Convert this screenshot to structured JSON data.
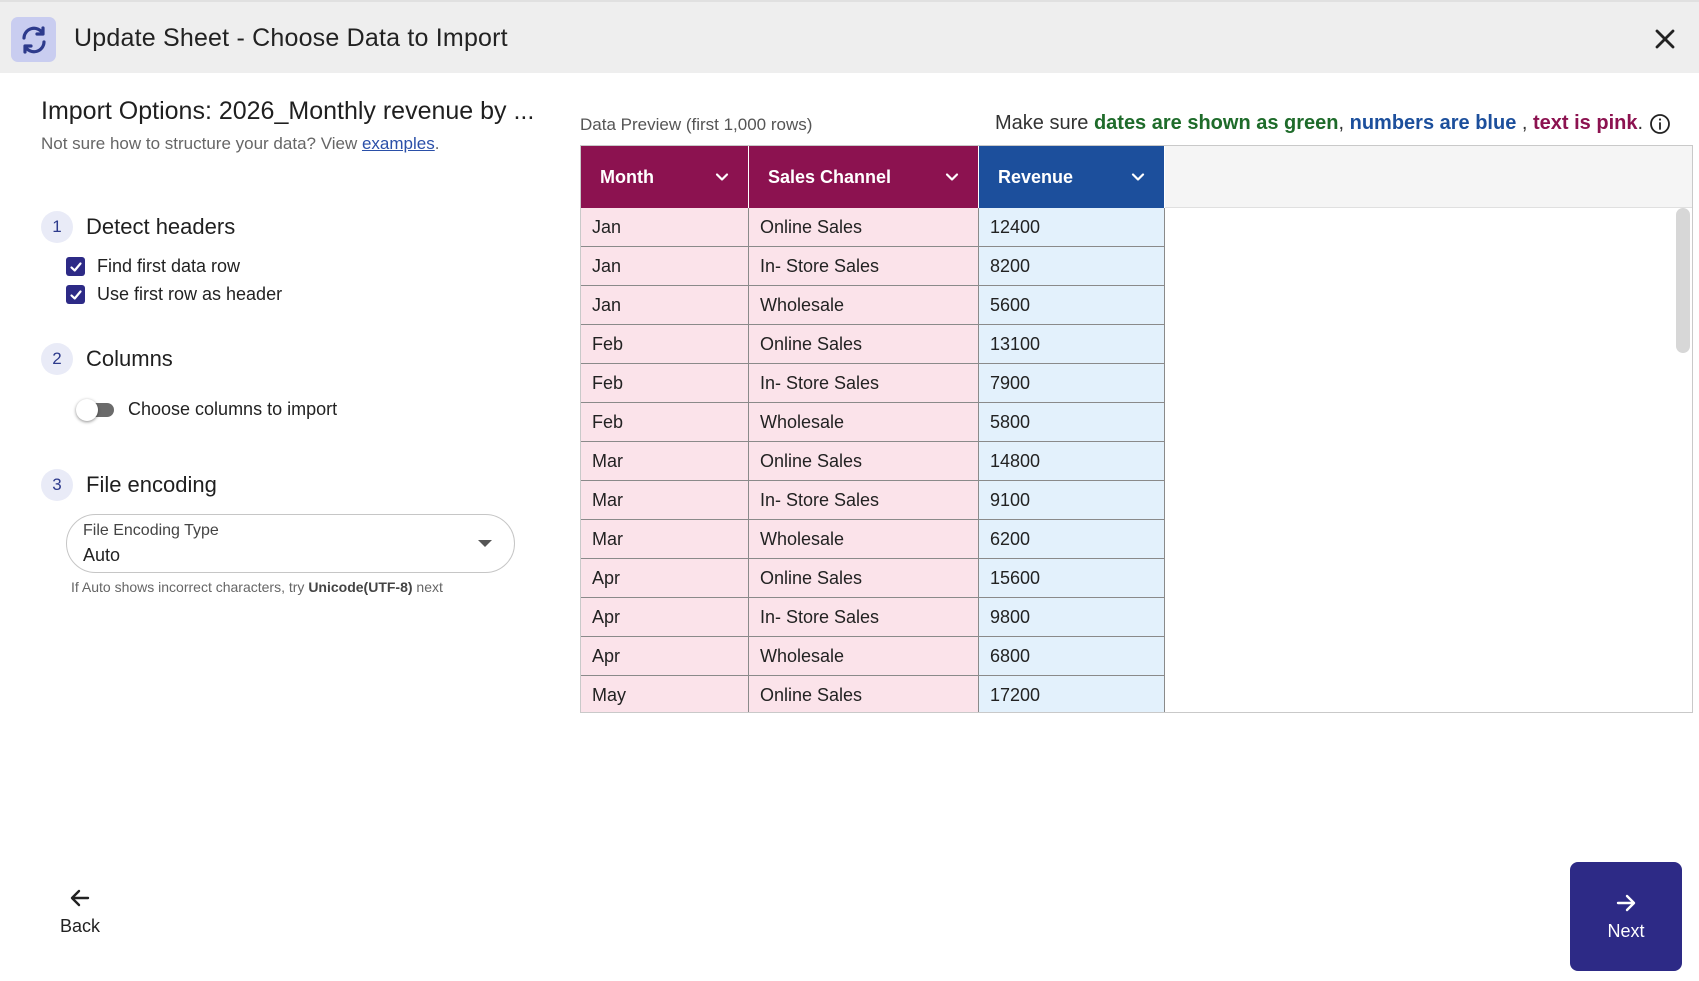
{
  "header": {
    "title": "Update Sheet - Choose Data to Import"
  },
  "options": {
    "title": "Import Options: 2026_Monthly revenue by ...",
    "subtitle_prefix": "Not sure how to structure your data? View ",
    "examples_link": "examples",
    "subtitle_suffix": "."
  },
  "steps": {
    "detect": {
      "number": "1",
      "label": "Detect headers",
      "find_first_row": {
        "label": "Find first data row",
        "checked": true
      },
      "use_header": {
        "label": "Use first row as header",
        "checked": true
      }
    },
    "columns": {
      "number": "2",
      "label": "Columns",
      "toggle_label": "Choose columns to import",
      "toggle_on": false
    },
    "encoding": {
      "number": "3",
      "label": "File encoding",
      "select_label": "File Encoding Type",
      "select_value": "Auto",
      "help_prefix": "If Auto shows incorrect characters, try ",
      "help_bold": "Unicode(UTF-8)",
      "help_suffix": " next"
    }
  },
  "preview": {
    "label": "Data Preview (first 1,000 rows)",
    "legend": {
      "prefix": "Make sure ",
      "green": "dates are shown as green",
      "sep1": ", ",
      "blue": "numbers are blue",
      "sep2": " , ",
      "pink": "text is pink",
      "suffix": "."
    },
    "columns": [
      {
        "name": "Month",
        "color": "#8c1250"
      },
      {
        "name": "Sales Channel",
        "color": "#8c1250"
      },
      {
        "name": "Revenue",
        "color": "#1c4f9c"
      }
    ],
    "rows": [
      [
        "Jan",
        "Online Sales",
        "12400"
      ],
      [
        "Jan",
        "In- Store Sales",
        "8200"
      ],
      [
        "Jan",
        "Wholesale",
        "5600"
      ],
      [
        "Feb",
        "Online Sales",
        "13100"
      ],
      [
        "Feb",
        "In- Store Sales",
        "7900"
      ],
      [
        "Feb",
        "Wholesale",
        "5800"
      ],
      [
        "Mar",
        "Online Sales",
        "14800"
      ],
      [
        "Mar",
        "In- Store Sales",
        "9100"
      ],
      [
        "Mar",
        "Wholesale",
        "6200"
      ],
      [
        "Apr",
        "Online Sales",
        "15600"
      ],
      [
        "Apr",
        "In- Store Sales",
        "9800"
      ],
      [
        "Apr",
        "Wholesale",
        "6800"
      ],
      [
        "May",
        "Online Sales",
        "17200"
      ]
    ]
  },
  "footer": {
    "back_label": "Back",
    "next_label": "Next"
  },
  "colors": {
    "accent": "#2d2a86",
    "text_type": "#8c1250",
    "number_type": "#1c4f9c",
    "date_type": "#1e6b2a",
    "text_cell_bg": "#fbe3ea",
    "number_cell_bg": "#e3f1fc"
  },
  "icons": {
    "app": "sync-icon",
    "close": "close-icon",
    "info": "info-icon",
    "column_menu": "chevron-down-icon",
    "back": "arrow-left-icon",
    "next": "arrow-right-icon",
    "select": "caret-down-icon",
    "check": "checkmark-icon"
  }
}
